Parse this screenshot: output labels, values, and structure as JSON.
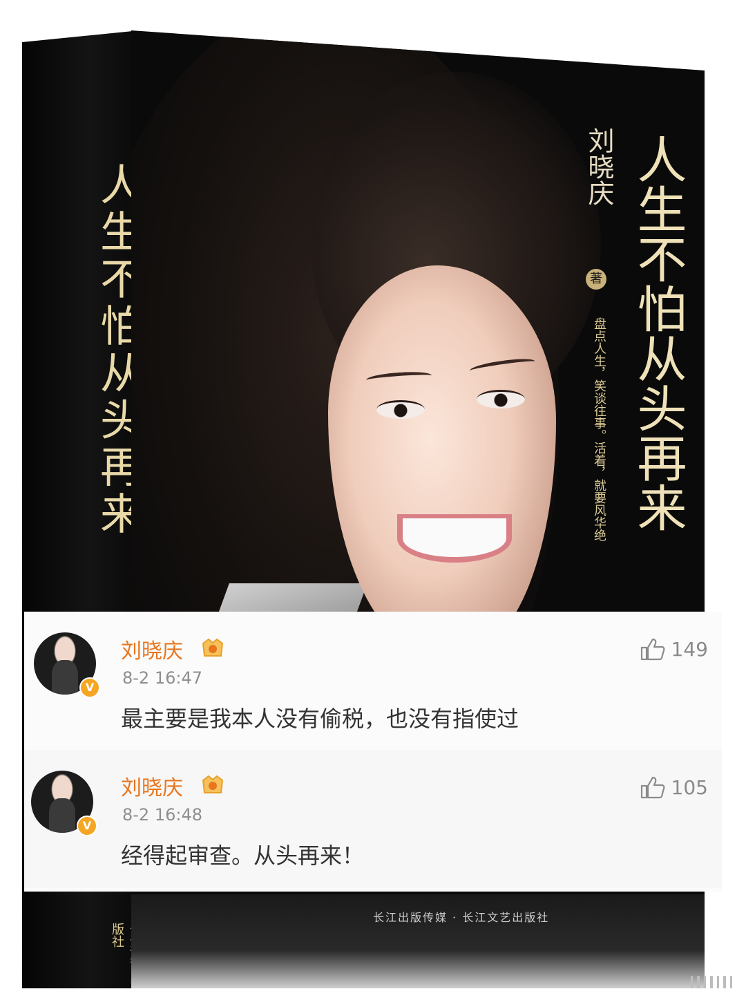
{
  "book": {
    "spine_title": "人生不怕从头再来",
    "spine_publisher": "长江文艺出版社",
    "author": "刘晓庆",
    "author_mark": "著",
    "cover_title": "人生不怕从头再来",
    "tagline": "盘点人生，笑谈往事。活着，就要风华绝",
    "front_publisher": "长江出版传媒 · 长江文艺出版社"
  },
  "comments": [
    {
      "username": "刘晓庆",
      "timestamp": "8-2 16:47",
      "text": "最主要是我本人没有偷税，也没有指使过",
      "likes": "149",
      "verified_symbol": "V"
    },
    {
      "username": "刘晓庆",
      "timestamp": "8-2 16:48",
      "text": "经得起审查。从头再来！",
      "likes": "105",
      "verified_symbol": "V"
    }
  ],
  "colors": {
    "username": "#e8761f",
    "badge": "#f5a623",
    "timestamp": "#8e8e8e",
    "text": "#333333"
  },
  "icons": [
    "thumbs-up-icon",
    "verified-icon",
    "vip-badge-icon",
    "scroll-icon"
  ]
}
